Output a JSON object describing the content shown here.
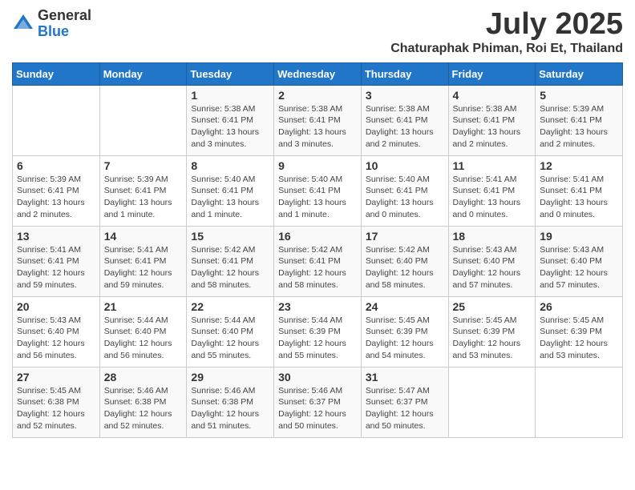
{
  "logo": {
    "general": "General",
    "blue": "Blue"
  },
  "title": {
    "month_year": "July 2025",
    "location": "Chaturaphak Phiman, Roi Et, Thailand"
  },
  "weekdays": [
    "Sunday",
    "Monday",
    "Tuesday",
    "Wednesday",
    "Thursday",
    "Friday",
    "Saturday"
  ],
  "weeks": [
    [
      {
        "day": "",
        "sunrise": "",
        "sunset": "",
        "daylight": ""
      },
      {
        "day": "",
        "sunrise": "",
        "sunset": "",
        "daylight": ""
      },
      {
        "day": "1",
        "sunrise": "Sunrise: 5:38 AM",
        "sunset": "Sunset: 6:41 PM",
        "daylight": "Daylight: 13 hours and 3 minutes."
      },
      {
        "day": "2",
        "sunrise": "Sunrise: 5:38 AM",
        "sunset": "Sunset: 6:41 PM",
        "daylight": "Daylight: 13 hours and 3 minutes."
      },
      {
        "day": "3",
        "sunrise": "Sunrise: 5:38 AM",
        "sunset": "Sunset: 6:41 PM",
        "daylight": "Daylight: 13 hours and 2 minutes."
      },
      {
        "day": "4",
        "sunrise": "Sunrise: 5:38 AM",
        "sunset": "Sunset: 6:41 PM",
        "daylight": "Daylight: 13 hours and 2 minutes."
      },
      {
        "day": "5",
        "sunrise": "Sunrise: 5:39 AM",
        "sunset": "Sunset: 6:41 PM",
        "daylight": "Daylight: 13 hours and 2 minutes."
      }
    ],
    [
      {
        "day": "6",
        "sunrise": "Sunrise: 5:39 AM",
        "sunset": "Sunset: 6:41 PM",
        "daylight": "Daylight: 13 hours and 2 minutes."
      },
      {
        "day": "7",
        "sunrise": "Sunrise: 5:39 AM",
        "sunset": "Sunset: 6:41 PM",
        "daylight": "Daylight: 13 hours and 1 minute."
      },
      {
        "day": "8",
        "sunrise": "Sunrise: 5:40 AM",
        "sunset": "Sunset: 6:41 PM",
        "daylight": "Daylight: 13 hours and 1 minute."
      },
      {
        "day": "9",
        "sunrise": "Sunrise: 5:40 AM",
        "sunset": "Sunset: 6:41 PM",
        "daylight": "Daylight: 13 hours and 1 minute."
      },
      {
        "day": "10",
        "sunrise": "Sunrise: 5:40 AM",
        "sunset": "Sunset: 6:41 PM",
        "daylight": "Daylight: 13 hours and 0 minutes."
      },
      {
        "day": "11",
        "sunrise": "Sunrise: 5:41 AM",
        "sunset": "Sunset: 6:41 PM",
        "daylight": "Daylight: 13 hours and 0 minutes."
      },
      {
        "day": "12",
        "sunrise": "Sunrise: 5:41 AM",
        "sunset": "Sunset: 6:41 PM",
        "daylight": "Daylight: 13 hours and 0 minutes."
      }
    ],
    [
      {
        "day": "13",
        "sunrise": "Sunrise: 5:41 AM",
        "sunset": "Sunset: 6:41 PM",
        "daylight": "Daylight: 12 hours and 59 minutes."
      },
      {
        "day": "14",
        "sunrise": "Sunrise: 5:41 AM",
        "sunset": "Sunset: 6:41 PM",
        "daylight": "Daylight: 12 hours and 59 minutes."
      },
      {
        "day": "15",
        "sunrise": "Sunrise: 5:42 AM",
        "sunset": "Sunset: 6:41 PM",
        "daylight": "Daylight: 12 hours and 58 minutes."
      },
      {
        "day": "16",
        "sunrise": "Sunrise: 5:42 AM",
        "sunset": "Sunset: 6:41 PM",
        "daylight": "Daylight: 12 hours and 58 minutes."
      },
      {
        "day": "17",
        "sunrise": "Sunrise: 5:42 AM",
        "sunset": "Sunset: 6:40 PM",
        "daylight": "Daylight: 12 hours and 58 minutes."
      },
      {
        "day": "18",
        "sunrise": "Sunrise: 5:43 AM",
        "sunset": "Sunset: 6:40 PM",
        "daylight": "Daylight: 12 hours and 57 minutes."
      },
      {
        "day": "19",
        "sunrise": "Sunrise: 5:43 AM",
        "sunset": "Sunset: 6:40 PM",
        "daylight": "Daylight: 12 hours and 57 minutes."
      }
    ],
    [
      {
        "day": "20",
        "sunrise": "Sunrise: 5:43 AM",
        "sunset": "Sunset: 6:40 PM",
        "daylight": "Daylight: 12 hours and 56 minutes."
      },
      {
        "day": "21",
        "sunrise": "Sunrise: 5:44 AM",
        "sunset": "Sunset: 6:40 PM",
        "daylight": "Daylight: 12 hours and 56 minutes."
      },
      {
        "day": "22",
        "sunrise": "Sunrise: 5:44 AM",
        "sunset": "Sunset: 6:40 PM",
        "daylight": "Daylight: 12 hours and 55 minutes."
      },
      {
        "day": "23",
        "sunrise": "Sunrise: 5:44 AM",
        "sunset": "Sunset: 6:39 PM",
        "daylight": "Daylight: 12 hours and 55 minutes."
      },
      {
        "day": "24",
        "sunrise": "Sunrise: 5:45 AM",
        "sunset": "Sunset: 6:39 PM",
        "daylight": "Daylight: 12 hours and 54 minutes."
      },
      {
        "day": "25",
        "sunrise": "Sunrise: 5:45 AM",
        "sunset": "Sunset: 6:39 PM",
        "daylight": "Daylight: 12 hours and 53 minutes."
      },
      {
        "day": "26",
        "sunrise": "Sunrise: 5:45 AM",
        "sunset": "Sunset: 6:39 PM",
        "daylight": "Daylight: 12 hours and 53 minutes."
      }
    ],
    [
      {
        "day": "27",
        "sunrise": "Sunrise: 5:45 AM",
        "sunset": "Sunset: 6:38 PM",
        "daylight": "Daylight: 12 hours and 52 minutes."
      },
      {
        "day": "28",
        "sunrise": "Sunrise: 5:46 AM",
        "sunset": "Sunset: 6:38 PM",
        "daylight": "Daylight: 12 hours and 52 minutes."
      },
      {
        "day": "29",
        "sunrise": "Sunrise: 5:46 AM",
        "sunset": "Sunset: 6:38 PM",
        "daylight": "Daylight: 12 hours and 51 minutes."
      },
      {
        "day": "30",
        "sunrise": "Sunrise: 5:46 AM",
        "sunset": "Sunset: 6:37 PM",
        "daylight": "Daylight: 12 hours and 50 minutes."
      },
      {
        "day": "31",
        "sunrise": "Sunrise: 5:47 AM",
        "sunset": "Sunset: 6:37 PM",
        "daylight": "Daylight: 12 hours and 50 minutes."
      },
      {
        "day": "",
        "sunrise": "",
        "sunset": "",
        "daylight": ""
      },
      {
        "day": "",
        "sunrise": "",
        "sunset": "",
        "daylight": ""
      }
    ]
  ]
}
